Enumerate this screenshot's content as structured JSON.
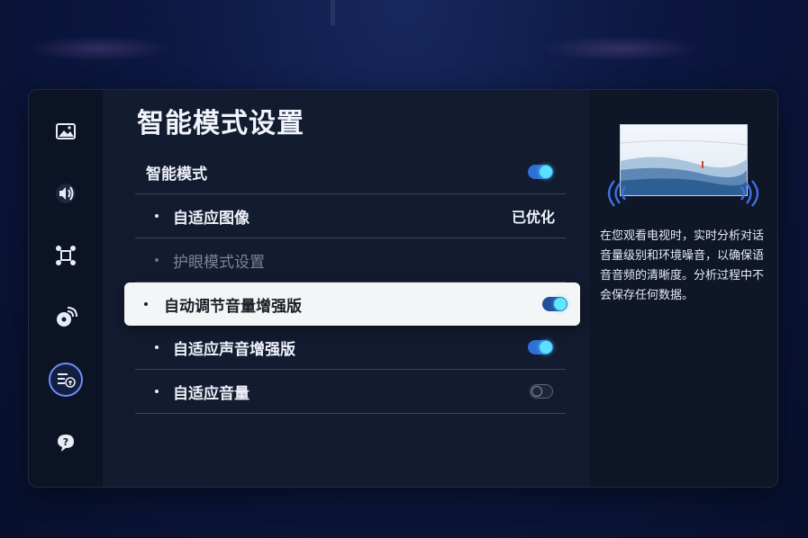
{
  "header": {
    "title": "智能模式设置"
  },
  "sidebar": {
    "items": [
      {
        "icon": "picture-icon"
      },
      {
        "icon": "sound-icon"
      },
      {
        "icon": "connection-icon"
      },
      {
        "icon": "broadcast-icon"
      },
      {
        "icon": "accessibility-list-icon",
        "active": true
      },
      {
        "icon": "support-icon"
      }
    ]
  },
  "settings": {
    "smart_mode": {
      "label": "智能模式",
      "on": true
    },
    "adaptive_picture": {
      "label": "自适应图像",
      "value": "已优化"
    },
    "eye_comfort": {
      "label": "护眼模式设置",
      "disabled": true
    },
    "auto_volume_boost": {
      "label": "自动调节音量增强版",
      "on": true,
      "focused": true
    },
    "adaptive_sound": {
      "label": "自适应声音增强版",
      "on": true
    },
    "adaptive_volume": {
      "label": "自适应音量",
      "on": false
    }
  },
  "info": {
    "description": "在您观看电视时，实时分析对话音量级别和环境噪音，以确保语音音频的清晰度。分析过程中不会保存任何数据。"
  },
  "colors": {
    "accent": "#5ce0ff",
    "toggle_track": "#2d6fd6",
    "focus_bg": "#f4f5f7"
  }
}
